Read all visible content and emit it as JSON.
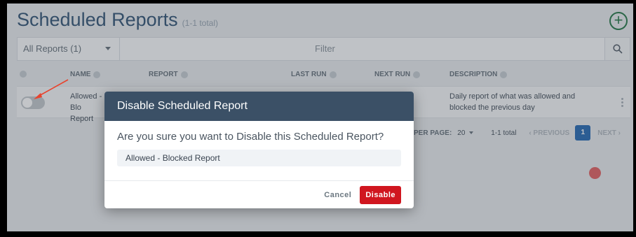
{
  "header": {
    "title": "Scheduled Reports",
    "count": "(1-1 total)",
    "add_icon": "plus-circle-icon"
  },
  "toolbar": {
    "report_select": "All Reports (1)",
    "filter_placeholder": "Filter",
    "search_icon": "search-icon"
  },
  "table": {
    "columns": [
      "NAME",
      "REPORT",
      "LAST RUN",
      "NEXT RUN",
      "DESCRIPTION"
    ],
    "rows": [
      {
        "enabled": false,
        "name": "Allowed - Blocked Report",
        "name_visible_line1": "Allowed - Blo",
        "name_visible_line2": "Report",
        "description": "Daily report of what was allowed and blocked the previous day"
      }
    ]
  },
  "pagination": {
    "per_page_label": "PER PAGE:",
    "per_page_value": "20",
    "total": "1-1 total",
    "previous": "PREVIOUS",
    "current_page": "1",
    "next": "NEXT"
  },
  "modal": {
    "title": "Disable Scheduled Report",
    "question": "Are you sure you want to Disable this Scheduled Report?",
    "report_name": "Allowed - Blocked Report",
    "cancel_label": "Cancel",
    "confirm_label": "Disable"
  },
  "colors": {
    "modal_header": "#3b5066",
    "confirm": "#d0161f",
    "accent": "#2f6fb6",
    "add": "#2e7d4f",
    "annotation_arrow": "#e8432d"
  }
}
